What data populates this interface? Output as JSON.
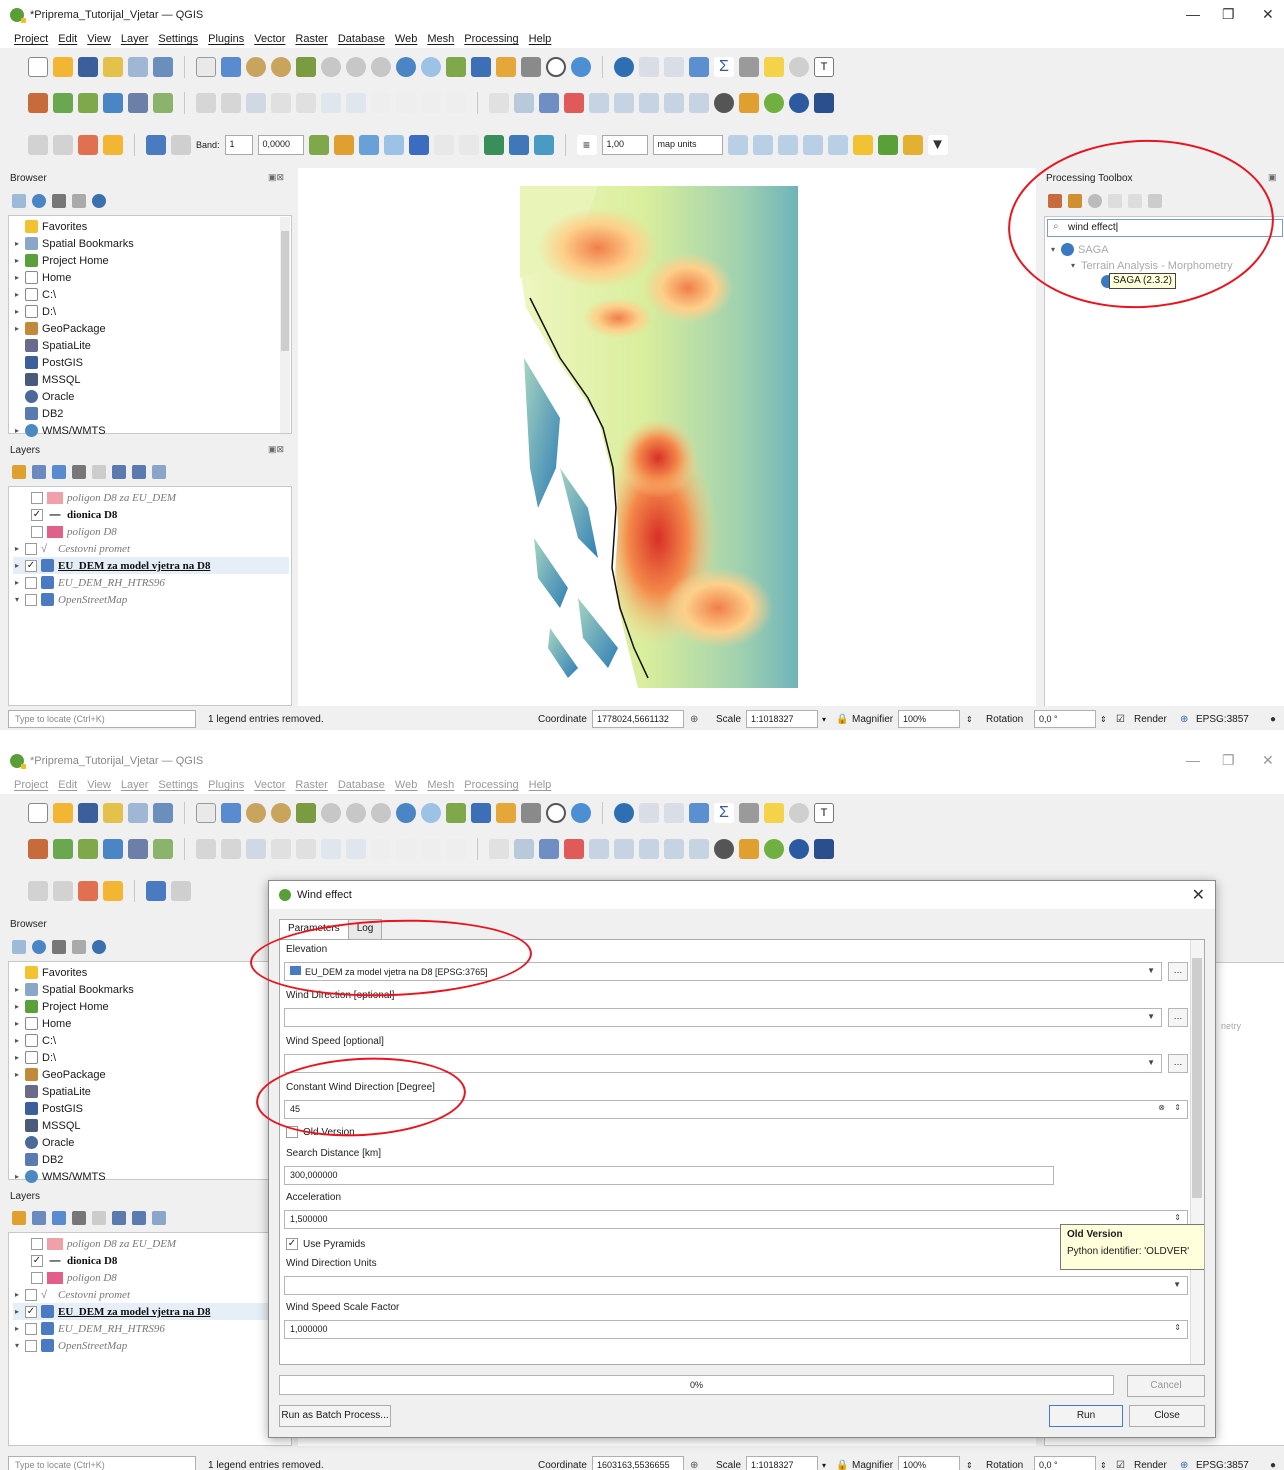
{
  "window1": {
    "title": "*Priprema_Tutorijal_Vjetar — QGIS",
    "menu": [
      "Project",
      "Edit",
      "View",
      "Layer",
      "Settings",
      "Plugins",
      "Vector",
      "Raster",
      "Database",
      "Web",
      "Mesh",
      "Processing",
      "Help"
    ],
    "toolbar3": {
      "band_label": "Band:",
      "band_value": "1",
      "value_field": "0,0000",
      "size_value": "1,00",
      "units_value": "map units"
    },
    "browser": {
      "title": "Browser",
      "items": [
        "Favorites",
        "Spatial Bookmarks",
        "Project Home",
        "Home",
        "C:\\",
        "D:\\",
        "GeoPackage",
        "SpatiaLite",
        "PostGIS",
        "MSSQL",
        "Oracle",
        "DB2",
        "WMS/WMTS"
      ]
    },
    "layers": {
      "title": "Layers",
      "items": [
        {
          "name": "poligon D8 za EU_DEM",
          "checked": false
        },
        {
          "name": "dionica D8",
          "checked": true
        },
        {
          "name": "poligon D8",
          "checked": false
        },
        {
          "name": "Cestovni promet",
          "checked": false
        },
        {
          "name": "EU_DEM za model vjetra na D8",
          "checked": true
        },
        {
          "name": "EU_DEM_RH_HTRS96",
          "checked": false
        },
        {
          "name": "OpenStreetMap",
          "checked": false
        }
      ]
    },
    "processing": {
      "title": "Processing Toolbox",
      "search_value": "wind effect",
      "tree_saga": "SAGA",
      "tree_group": "Terrain Analysis - Morphometry",
      "tooltip": "SAGA (2.3.2)"
    },
    "status": {
      "locate_placeholder": "Type to locate (Ctrl+K)",
      "message": "1 legend entries removed.",
      "coordinate_label": "Coordinate",
      "coordinate_value": "1778024,5661132",
      "scale_label": "Scale",
      "scale_value": "1:1018327",
      "magnifier_label": "Magnifier",
      "magnifier_value": "100%",
      "rotation_label": "Rotation",
      "rotation_value": "0,0 °",
      "render_label": "Render",
      "crs": "EPSG:3857"
    }
  },
  "window2": {
    "title": "*Priprema_Tutorijal_Vjetar — QGIS",
    "menu": [
      "Project",
      "Edit",
      "View",
      "Layer",
      "Settings",
      "Plugins",
      "Vector",
      "Raster",
      "Database",
      "Web",
      "Mesh",
      "Processing",
      "Help"
    ],
    "status": {
      "locate_placeholder": "Type to locate (Ctrl+K)",
      "message": "1 legend entries removed.",
      "coordinate_label": "Coordinate",
      "coordinate_value": "1603163,5536655",
      "scale_label": "Scale",
      "scale_value": "1:1018327",
      "magnifier_label": "Magnifier",
      "magnifier_value": "100%",
      "rotation_label": "Rotation",
      "rotation_value": "0,0 °",
      "render_label": "Render",
      "crs": "EPSG:3857"
    },
    "bg_processing_fragment": "netry",
    "dialog": {
      "title": "Wind effect",
      "tabs": [
        "Parameters",
        "Log"
      ],
      "elevation_label": "Elevation",
      "elevation_value": "EU_DEM za model vjetra na D8 [EPSG:3765]",
      "wind_direction_label": "Wind Direction [optional]",
      "wind_speed_label": "Wind Speed [optional]",
      "const_dir_label": "Constant Wind Direction [Degree]",
      "const_dir_value": "45",
      "old_version_label": "Old Version",
      "search_distance_label": "Search Distance [km]",
      "search_distance_value": "300,000000",
      "acceleration_label": "Acceleration",
      "acceleration_value": "1,500000",
      "use_pyramids_label": "Use Pyramids",
      "wind_dir_units_label": "Wind Direction Units",
      "wind_speed_scale_label": "Wind Speed Scale Factor",
      "wind_speed_scale_value": "1,000000",
      "tooltip_title": "Old Version",
      "tooltip_text": "Python identifier: 'OLDVER'",
      "progress": "0%",
      "batch_button": "Run as Batch Process...",
      "cancel_button": "Cancel",
      "run_button": "Run",
      "close_button": "Close"
    }
  },
  "colors": {
    "annotation_red": "#e8141e",
    "dem_low": "#2f7fb5",
    "dem_mid": "#e9f2b0",
    "dem_high": "#d7301f"
  }
}
